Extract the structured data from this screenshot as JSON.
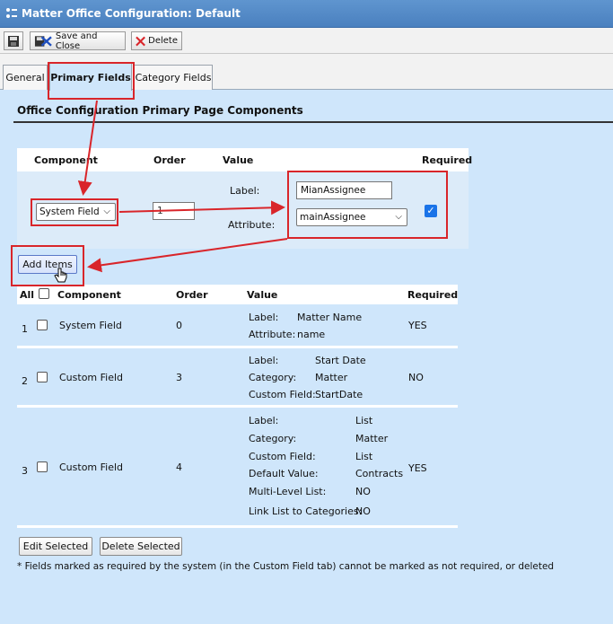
{
  "window": {
    "title": "Matter Office Configuration: Default"
  },
  "toolbar": {
    "save_icon": "floppy-disk-icon",
    "save_close_label": "Save and Close",
    "delete_label": "Delete"
  },
  "tabs": [
    {
      "label": "General"
    },
    {
      "label": "Primary Fields",
      "active": true
    },
    {
      "label": "Category Fields"
    }
  ],
  "section": {
    "title": "Office Configuration Primary Page Components"
  },
  "add_form": {
    "headers": {
      "component": "Component",
      "order": "Order",
      "value": "Value",
      "required": "Required"
    },
    "component_select": "System Field",
    "order_value": "1",
    "label_caption": "Label:",
    "label_value": "MianAssignee",
    "attribute_caption": "Attribute:",
    "attribute_select": "mainAssignee",
    "required_checked": true,
    "add_button": "Add Items"
  },
  "list": {
    "headers": {
      "all": "All",
      "component": "Component",
      "order": "Order",
      "value": "Value",
      "required": "Required"
    },
    "rows": [
      {
        "index": "1",
        "component": "System Field",
        "order": "0",
        "required": "YES",
        "value_lines": [
          {
            "k": "Label:",
            "v": "Matter Name"
          },
          {
            "k": "Attribute:",
            "v": "name"
          }
        ]
      },
      {
        "index": "2",
        "component": "Custom Field",
        "order": "3",
        "required": "NO",
        "value_lines": [
          {
            "k": "Label:",
            "v": "Start Date"
          },
          {
            "k": "Category:",
            "v": "Matter"
          },
          {
            "k": "Custom Field:",
            "v": "StartDate"
          }
        ]
      },
      {
        "index": "3",
        "component": "Custom Field",
        "order": "4",
        "required": "YES",
        "value_lines": [
          {
            "k": "Label:",
            "v": "List"
          },
          {
            "k": "Category:",
            "v": "Matter"
          },
          {
            "k": "Custom Field:",
            "v": "List"
          },
          {
            "k": "Default Value:",
            "v": "Contracts"
          },
          {
            "k": "Multi-Level List:",
            "v": "NO"
          },
          {
            "k": "Link List to Categories:",
            "v": "NO"
          }
        ]
      }
    ]
  },
  "buttons": {
    "edit_selected": "Edit Selected",
    "delete_selected": "Delete Selected"
  },
  "footnote": "* Fields marked as required by the system (in the Custom Field tab) cannot be marked as not required, or deleted",
  "colors": {
    "annotation": "#d9252a",
    "background": "#cfe6fb",
    "title_bar": "#4a80bf"
  }
}
